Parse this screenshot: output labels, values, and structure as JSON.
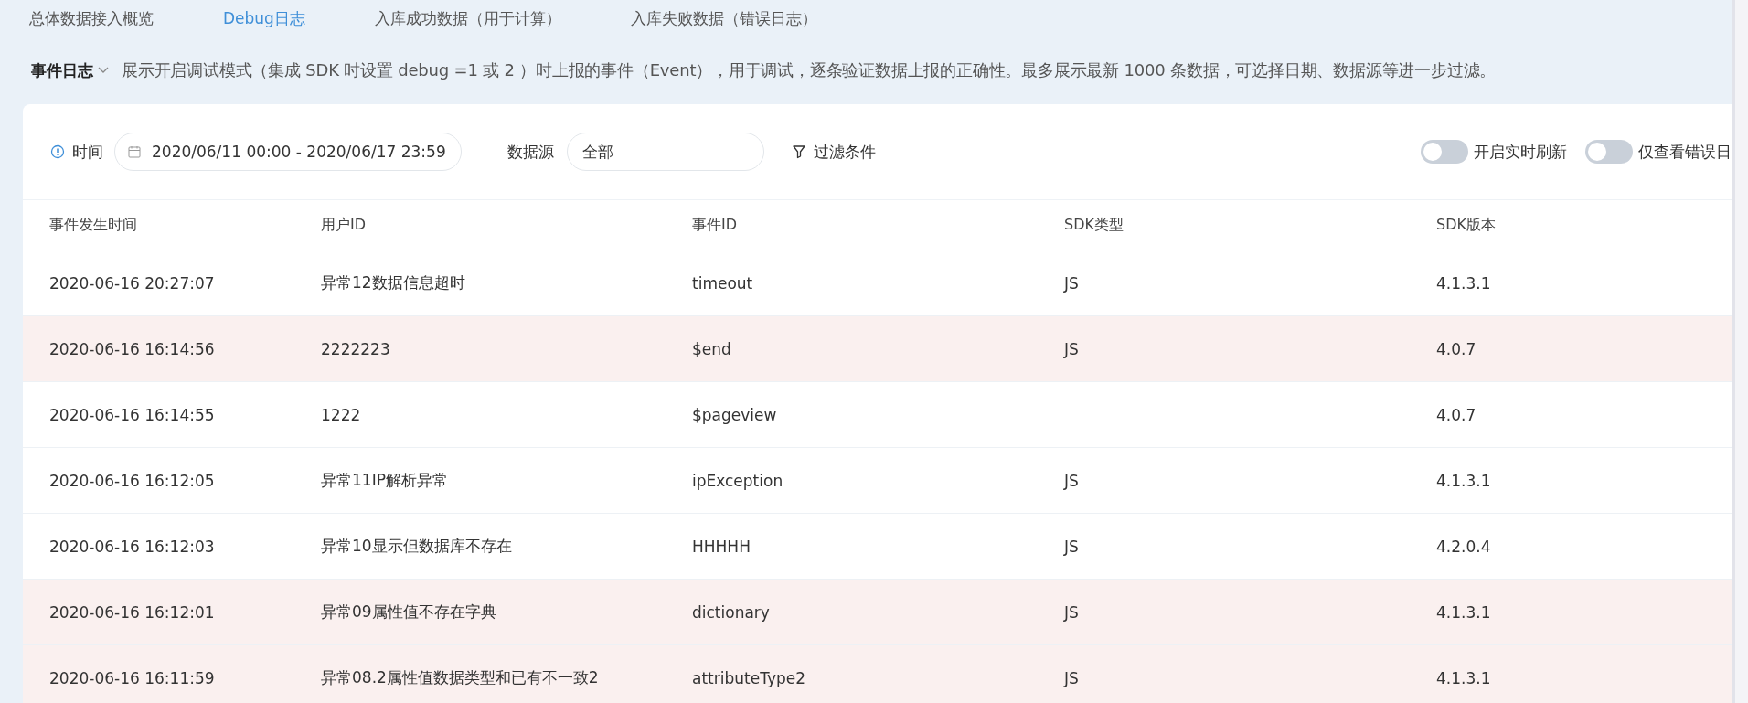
{
  "tabs": [
    {
      "label": "总体数据接入概览",
      "selected": false
    },
    {
      "label": "Debug日志",
      "selected": true
    },
    {
      "label": "入库成功数据（用于计算）",
      "selected": false
    },
    {
      "label": "入库失败数据（错误日志）",
      "selected": false
    }
  ],
  "section": {
    "title": "事件日志",
    "description": "展示开启调试模式（集成 SDK 时设置 debug =1 或 2 ）时上报的事件（Event），用于调试，逐条验证数据上报的正确性。最多展示最新 1000 条数据，可选择日期、数据源等进一步过滤。"
  },
  "filters": {
    "time_label": "时间",
    "date_range": "2020/06/11 00:00 - 2020/06/17 23:59",
    "source_label": "数据源",
    "source_value": "全部",
    "filter_button": "过滤条件",
    "toggles": [
      {
        "label": "开启实时刷新",
        "on": false
      },
      {
        "label": "仅查看错误日",
        "on": false
      }
    ]
  },
  "table": {
    "columns": [
      "事件发生时间",
      "用户ID",
      "事件ID",
      "SDK类型",
      "SDK版本"
    ],
    "rows": [
      {
        "error": false,
        "cells": [
          "2020-06-16 20:27:07",
          "异常12数据信息超时",
          "timeout",
          "JS",
          "4.1.3.1"
        ]
      },
      {
        "error": true,
        "cells": [
          "2020-06-16 16:14:56",
          "2222223",
          "$end",
          "JS",
          "4.0.7"
        ]
      },
      {
        "error": false,
        "cells": [
          "2020-06-16 16:14:55",
          "1222",
          "$pageview",
          "",
          "4.0.7"
        ]
      },
      {
        "error": false,
        "cells": [
          "2020-06-16 16:12:05",
          "异常11IP解析异常",
          "ipException",
          "JS",
          "4.1.3.1"
        ]
      },
      {
        "error": false,
        "cells": [
          "2020-06-16 16:12:03",
          "异常10显示但数据库不存在",
          "HHHHH",
          "JS",
          "4.2.0.4"
        ]
      },
      {
        "error": true,
        "cells": [
          "2020-06-16 16:12:01",
          "异常09属性值不存在字典",
          "dictionary",
          "JS",
          "4.1.3.1"
        ]
      },
      {
        "error": true,
        "cells": [
          "2020-06-16 16:11:59",
          "异常08.2属性值数据类型和已有不一致2",
          "attributeType2",
          "JS",
          "4.1.3.1"
        ]
      }
    ]
  }
}
